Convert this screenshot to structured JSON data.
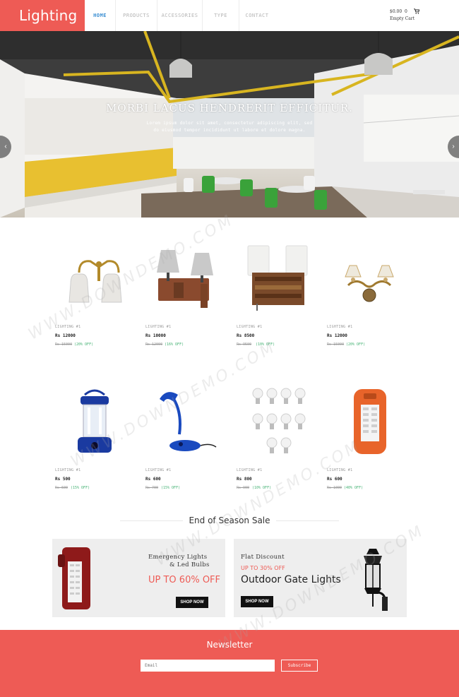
{
  "header": {
    "logo": "Lighting",
    "nav": [
      {
        "label": "HOME",
        "active": true
      },
      {
        "label": "PRODUCTS",
        "active": false
      },
      {
        "label": "ACCESSORIES",
        "active": false
      },
      {
        "label": "TYPE",
        "active": false
      },
      {
        "label": "CONTACT",
        "active": false
      }
    ],
    "cart_total": "$0.00",
    "cart_count": "0",
    "cart_status": "Empty Cart"
  },
  "hero": {
    "title": "MORBI LACUS HENDRERIT EFFICITUR.",
    "subtitle": "Lorem ipsum dolor sit amet, consectetur adipiscing elit, sed do eiusmod tempor incididunt ut labore et dolore magna.",
    "prev_icon": "chevron-left-icon",
    "next_icon": "chevron-right-icon"
  },
  "products": [
    {
      "category": "LIGHTING #1",
      "price": "Rs 12000",
      "old_price": "Rs 15000",
      "discount": "(20% OFF)"
    },
    {
      "category": "LIGHTING #1",
      "price": "Rs 10000",
      "old_price": "Rs 12000",
      "discount": "(16% OFF)"
    },
    {
      "category": "LIGHTING #1",
      "price": "Rs 8500",
      "old_price": "Rs 9500",
      "discount": "(10% OFF)"
    },
    {
      "category": "LIGHTING #1",
      "price": "Rs 12000",
      "old_price": "Rs 15000",
      "discount": "(20% OFF)"
    },
    {
      "category": "LIGHTING #1",
      "price": "Rs 500",
      "old_price": "Rs 600",
      "discount": "(15% OFF)"
    },
    {
      "category": "LIGHTING #1",
      "price": "Rs 600",
      "old_price": "Rs 700",
      "discount": "(15% OFF)"
    },
    {
      "category": "LIGHTING #1",
      "price": "Rs 800",
      "old_price": "Rs 900",
      "discount": "(10% OFF)"
    },
    {
      "category": "LIGHTING #1",
      "price": "Rs 600",
      "old_price": "Rs 1000",
      "discount": "(40% OFF)"
    }
  ],
  "sale": {
    "title": "End of Season Sale",
    "banner1": {
      "line1": "Emergency Lights",
      "line2": "& Led Bulbs",
      "offer": "UP TO 60% OFF",
      "button": "SHOP NOW"
    },
    "banner2": {
      "label": "Flat Discount",
      "offer": "UP TO 30% OFF",
      "title": "Outdoor Gate Lights",
      "button": "SHOP NOW"
    }
  },
  "newsletter": {
    "title": "Newsletter",
    "email_placeholder": "Email",
    "button": "Subscribe"
  },
  "watermark": "WWW.DOWNDEMO.COM",
  "colors": {
    "accent": "#ee5b55",
    "nav_active": "#3a8ed2",
    "discount": "#40b070"
  }
}
